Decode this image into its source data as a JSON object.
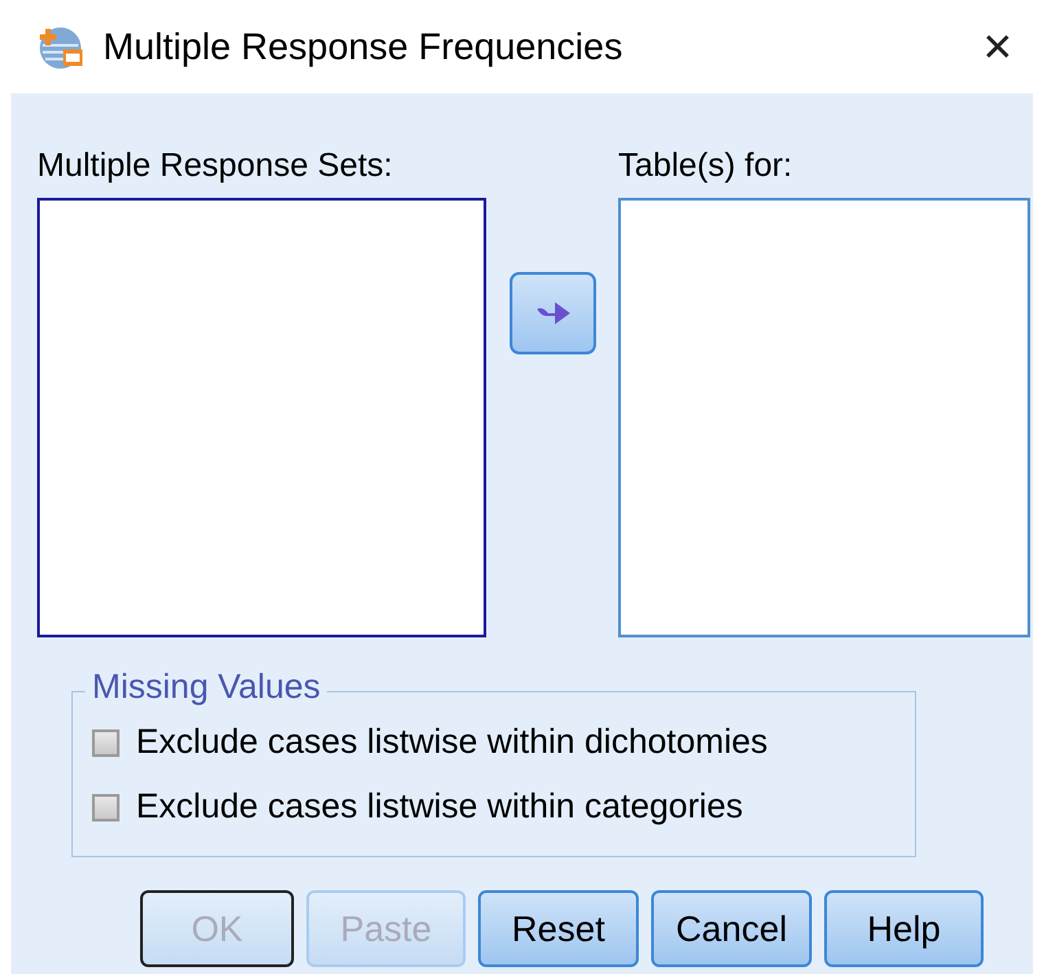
{
  "window": {
    "title": "Multiple Response Frequencies",
    "close": "✕"
  },
  "source_list": {
    "label": "Multiple Response Sets:"
  },
  "target_list": {
    "label": "Table(s) for:"
  },
  "missing_values": {
    "title": "Missing Values",
    "options": [
      {
        "label": "Exclude cases listwise within dichotomies",
        "checked": false
      },
      {
        "label": "Exclude cases listwise within categories",
        "checked": false
      }
    ]
  },
  "buttons": [
    {
      "label": "OK",
      "disabled": true,
      "default": true
    },
    {
      "label": "Paste",
      "disabled": true,
      "default": false
    },
    {
      "label": "Reset",
      "disabled": false,
      "default": false
    },
    {
      "label": "Cancel",
      "disabled": false,
      "default": false
    },
    {
      "label": "Help",
      "disabled": false,
      "default": false
    }
  ]
}
